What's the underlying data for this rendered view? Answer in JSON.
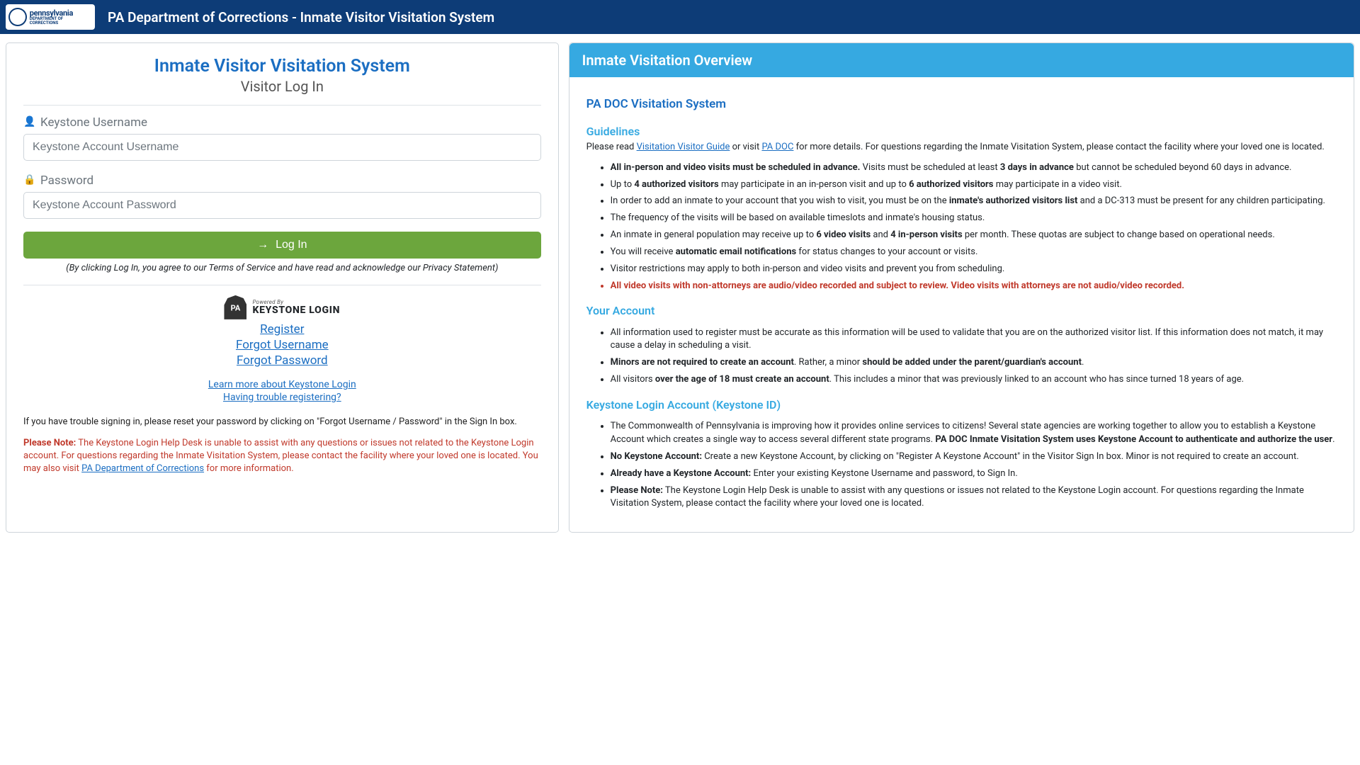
{
  "header": {
    "logo_top": "pennsylvania",
    "logo_bottom": "DEPARTMENT OF CORRECTIONS",
    "title": "PA Department of Corrections - Inmate Visitor Visitation System"
  },
  "login": {
    "title": "Inmate Visitor Visitation System",
    "subtitle": "Visitor Log In",
    "username_label": "Keystone Username",
    "username_placeholder": "Keystone Account Username",
    "password_label": "Password",
    "password_placeholder": "Keystone Account Password",
    "login_button": "Log In",
    "tos_note": "(By clicking Log In, you agree to our Terms of Service and have read and acknowledge our Privacy Statement)",
    "keystone_logo_poweredby": "Powered By",
    "keystone_logo_text": "KEYSTONE LOGIN",
    "register": "Register",
    "forgot_username": "Forgot Username",
    "forgot_password": "Forgot Password",
    "learn_more": "Learn more about Keystone Login",
    "trouble_registering": "Having trouble registering?",
    "trouble_signin": "If you have trouble signing in, please reset your password by clicking on \"Forgot Username / Password\" in the Sign In box.",
    "note_label": "Please Note:",
    "note_text_before_link": " The Keystone Login Help Desk is unable to assist with any questions or issues not related to the Keystone Login account. For questions regarding the Inmate Visitation System, please contact the facility where your loved one is located. You may also visit ",
    "note_link_text": "PA Department of Corrections",
    "note_text_after_link": " for more information."
  },
  "overview": {
    "header": "Inmate Visitation Overview",
    "pa_doc_title": "PA DOC Visitation System",
    "guidelines_title": "Guidelines",
    "guidelines_intro_before": "Please read ",
    "guidelines_link1": "Visitation Visitor Guide",
    "guidelines_intro_mid": " or visit ",
    "guidelines_link2": "PA DOC",
    "guidelines_intro_after": " for more details. For questions regarding the Inmate Visitation System, please contact the facility where your loved one is located.",
    "g1_bold": "All in-person and video visits must be scheduled in advance.",
    "g1_mid": " Visits must be scheduled at least ",
    "g1_bold2": "3 days in advance",
    "g1_after": " but cannot be scheduled beyond 60 days in advance.",
    "g2_before": "Up to ",
    "g2_b1": "4 authorized visitors",
    "g2_mid": " may participate in an in-person visit and up to ",
    "g2_b2": "6 authorized visitors",
    "g2_after": " may participate in a video visit.",
    "g3_before": "In order to add an inmate to your account that you wish to visit, you must be on the ",
    "g3_b1": "inmate's authorized visitors list",
    "g3_after": " and a DC-313 must be present for any children participating.",
    "g4": "The frequency of the visits will be based on available timeslots and inmate's housing status.",
    "g5_before": "An inmate in general population may receive up to ",
    "g5_b1": "6 video visits",
    "g5_mid": " and ",
    "g5_b2": "4 in-person visits",
    "g5_after": " per month. These quotas are subject to change based on operational needs.",
    "g6_before": "You will receive ",
    "g6_b1": "automatic email notifications",
    "g6_after": " for status changes to your account or visits.",
    "g7": "Visitor restrictions may apply to both in-person and video visits and prevent you from scheduling.",
    "g8": "All video visits with non-attorneys are audio/video recorded and subject to review. Video visits with attorneys are not audio/video recorded.",
    "your_account_title": "Your Account",
    "ya1": "All information used to register must be accurate as this information will be used to validate that you are on the authorized visitor list. If this information does not match, it may cause a delay in scheduling a visit.",
    "ya2_b": "Minors are not required to create an account",
    "ya2_mid": ". Rather, a minor ",
    "ya2_b2": "should be added under the parent/guardian's account",
    "ya2_after": ".",
    "ya3_before": "All visitors ",
    "ya3_b": "over the age of 18 must create an account",
    "ya3_after": ". This includes a minor that was previously linked to an account who has since turned 18 years of age.",
    "keystone_title": "Keystone Login Account (Keystone ID)",
    "ks1_before": "The Commonwealth of Pennsylvania is improving how it provides online services to citizens! Several state agencies are working together to allow you to establish a Keystone Account which creates a single way to access several different state programs. ",
    "ks1_b": "PA DOC Inmate Visitation System uses Keystone Account to authenticate and authorize the user",
    "ks1_after": ".",
    "ks2_b": "No Keystone Account:",
    "ks2_after": " Create a new Keystone Account, by clicking on \"Register A Keystone Account\" in the Visitor Sign In box. Minor is not required to create an account.",
    "ks3_b": "Already have a Keystone Account:",
    "ks3_after": " Enter your existing Keystone Username and password, to Sign In.",
    "ks4_b": "Please Note:",
    "ks4_after": " The Keystone Login Help Desk is unable to assist with any questions or issues not related to the Keystone Login account. For questions regarding the Inmate Visitation System, please contact the facility where your loved one is located."
  }
}
